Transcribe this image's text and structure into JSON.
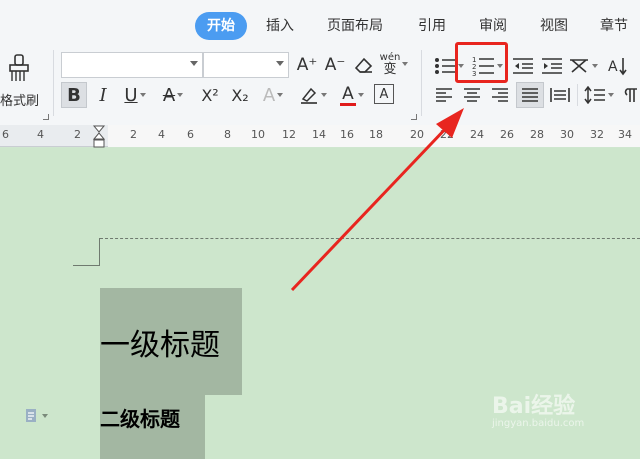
{
  "tabs": [
    {
      "label": "开始",
      "active": true
    },
    {
      "label": "插入",
      "active": false
    },
    {
      "label": "页面布局",
      "active": false
    },
    {
      "label": "引用",
      "active": false
    },
    {
      "label": "审阅",
      "active": false
    },
    {
      "label": "视图",
      "active": false
    },
    {
      "label": "章节",
      "active": false
    }
  ],
  "toolbar": {
    "format_painter_label": "格式刷",
    "font_name_value": "",
    "font_size_value": "",
    "bold_glyph": "B",
    "italic_glyph": "I",
    "underline_glyph": "U",
    "strike_glyph": "A",
    "superscript_glyph": "X²",
    "subscript_glyph": "X₂",
    "text_effect_glyph": "A",
    "font_color_glyph": "A",
    "char_border_glyph": "A",
    "grow_font_glyph": "A⁺",
    "shrink_font_glyph": "A⁻",
    "phonetic_glyph": "wén",
    "numbered_list_glyph": "1 2 3"
  },
  "ruler": {
    "labels": [
      "6",
      "4",
      "2",
      "2",
      "4",
      "6",
      "8",
      "10",
      "12",
      "14",
      "16",
      "18",
      "20",
      "22",
      "24",
      "26",
      "28",
      "30",
      "32",
      "34",
      "36"
    ]
  },
  "document": {
    "heading1": "一级标题",
    "heading2": "二级标题"
  },
  "colors": {
    "accent_tab": "#4b9cf1",
    "highlight_box": "#e8251f",
    "arrow": "#e8251f",
    "doc_bg": "#cde6cc",
    "heading_bg": "#a3b7a2",
    "font_color_bar": "#e01b1b"
  },
  "watermark": {
    "brand": "Bai经验",
    "url": "jingyan.baidu.com"
  }
}
